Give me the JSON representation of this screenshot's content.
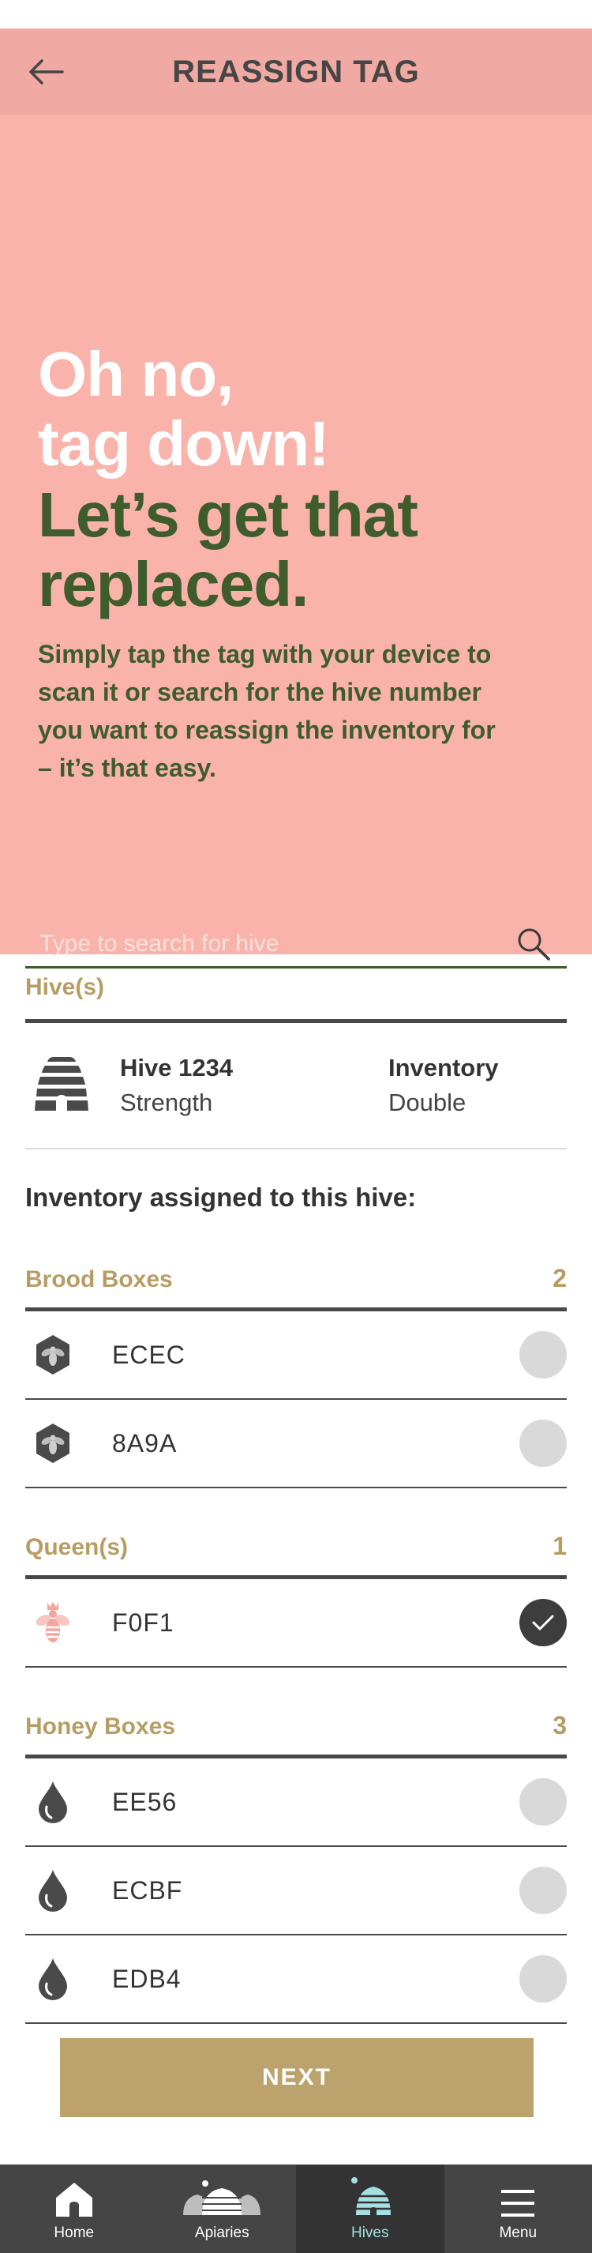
{
  "header": {
    "title": "REASSIGN TAG"
  },
  "hero": {
    "headline_white_1": "Oh no,",
    "headline_white_2": "tag down!",
    "headline_green_1": "Let’s get that",
    "headline_green_2": "replaced.",
    "description": "Simply tap the tag with your device to scan it or search for the hive number you want to reassign the inventory for – it’s that easy."
  },
  "search": {
    "placeholder": "Type to search for hive",
    "value": ""
  },
  "hive_section": {
    "label": "Hive(s)",
    "hive": {
      "name": "Hive 1234",
      "metric_label": "Strength",
      "inventory_label": "Inventory",
      "inventory_value": "Double"
    }
  },
  "inventory_title": "Inventory assigned to this hive:",
  "brood": {
    "label": "Brood Boxes",
    "count": "2",
    "items": [
      {
        "code": "ECEC",
        "checked": false
      },
      {
        "code": "8A9A",
        "checked": false
      }
    ]
  },
  "queens": {
    "label": "Queen(s)",
    "count": "1",
    "items": [
      {
        "code": "F0F1",
        "checked": true
      }
    ]
  },
  "honey": {
    "label": "Honey Boxes",
    "count": "3",
    "items": [
      {
        "code": "EE56",
        "checked": false
      },
      {
        "code": "ECBF",
        "checked": false
      },
      {
        "code": "EDB4",
        "checked": false
      }
    ]
  },
  "actions": {
    "next_label": "NEXT"
  },
  "tabbar": {
    "active": "Hives",
    "tabs": [
      {
        "label": "Home"
      },
      {
        "label": "Apiaries"
      },
      {
        "label": "Hives"
      },
      {
        "label": "Menu"
      }
    ]
  },
  "colors": {
    "hero_bg": "#f9b3ab",
    "topbar_bg": "#f0a9a3",
    "green": "#3e5c2c",
    "gold": "#b79d64",
    "button": "#bca36e",
    "tabbar_bg": "#454545",
    "tab_active": "#a6dfe0",
    "queen_pink": "#f3a59e"
  },
  "icons": {
    "back": "arrow-left-icon",
    "search": "search-icon",
    "hive": "beehive-icon",
    "brood": "bee-hexagon-icon",
    "queen": "queen-bee-icon",
    "honey": "honey-drop-icon",
    "check": "checkmark-icon",
    "home": "home-icon",
    "apiaries": "apiaries-icon",
    "hives": "hives-icon",
    "menu": "hamburger-menu-icon"
  }
}
